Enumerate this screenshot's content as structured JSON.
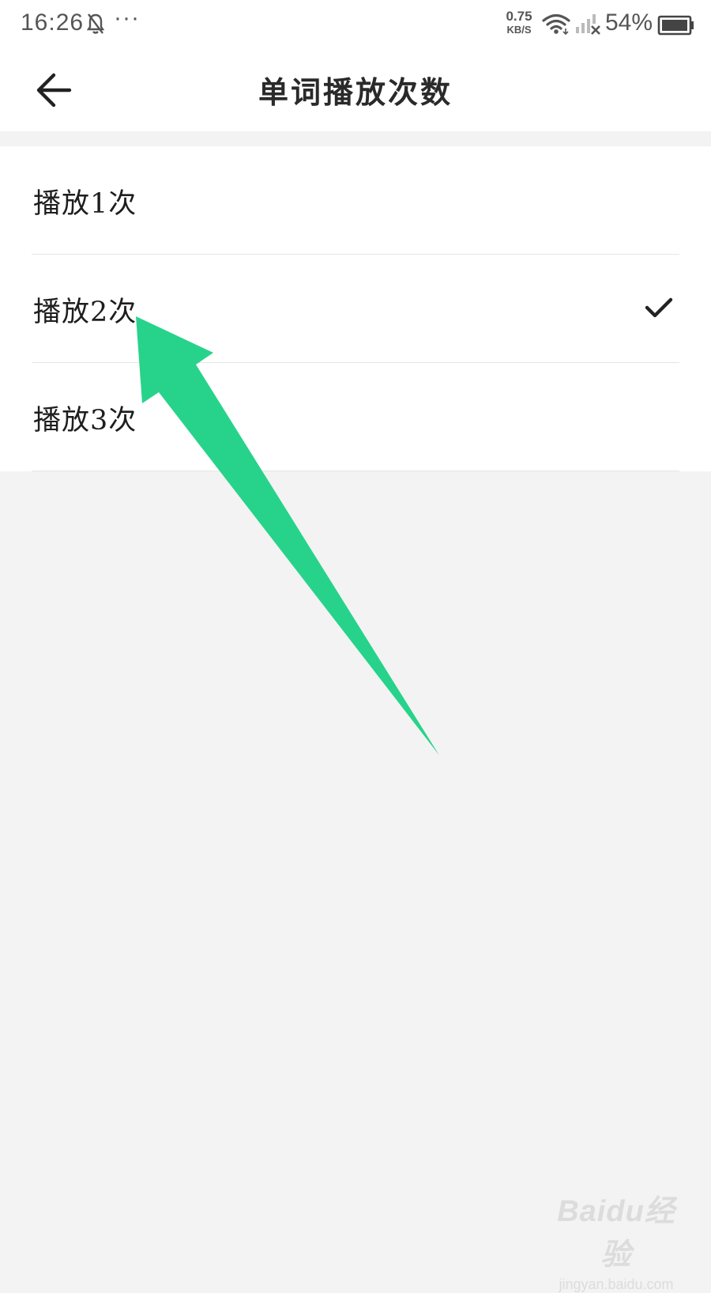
{
  "status_bar": {
    "time": "16:26",
    "more": "···",
    "net_speed_value": "0.75",
    "net_speed_unit": "KB/S",
    "battery": "54%",
    "icons": [
      "bell-off-icon",
      "wifi-icon",
      "no-signal-icon",
      "battery-icon"
    ]
  },
  "header": {
    "title": "单词播放次数",
    "back_icon": "arrow-left-icon"
  },
  "options": [
    {
      "label": "播放1次",
      "selected": false
    },
    {
      "label": "播放2次",
      "selected": true
    },
    {
      "label": "播放3次",
      "selected": false
    }
  ],
  "watermark": {
    "brand": "Baidu经验",
    "url": "jingyan.baidu.com"
  },
  "colors": {
    "annotation_arrow": "#27d38a",
    "background": "#f3f3f3",
    "surface": "#ffffff",
    "text": "#1e1e1e"
  }
}
